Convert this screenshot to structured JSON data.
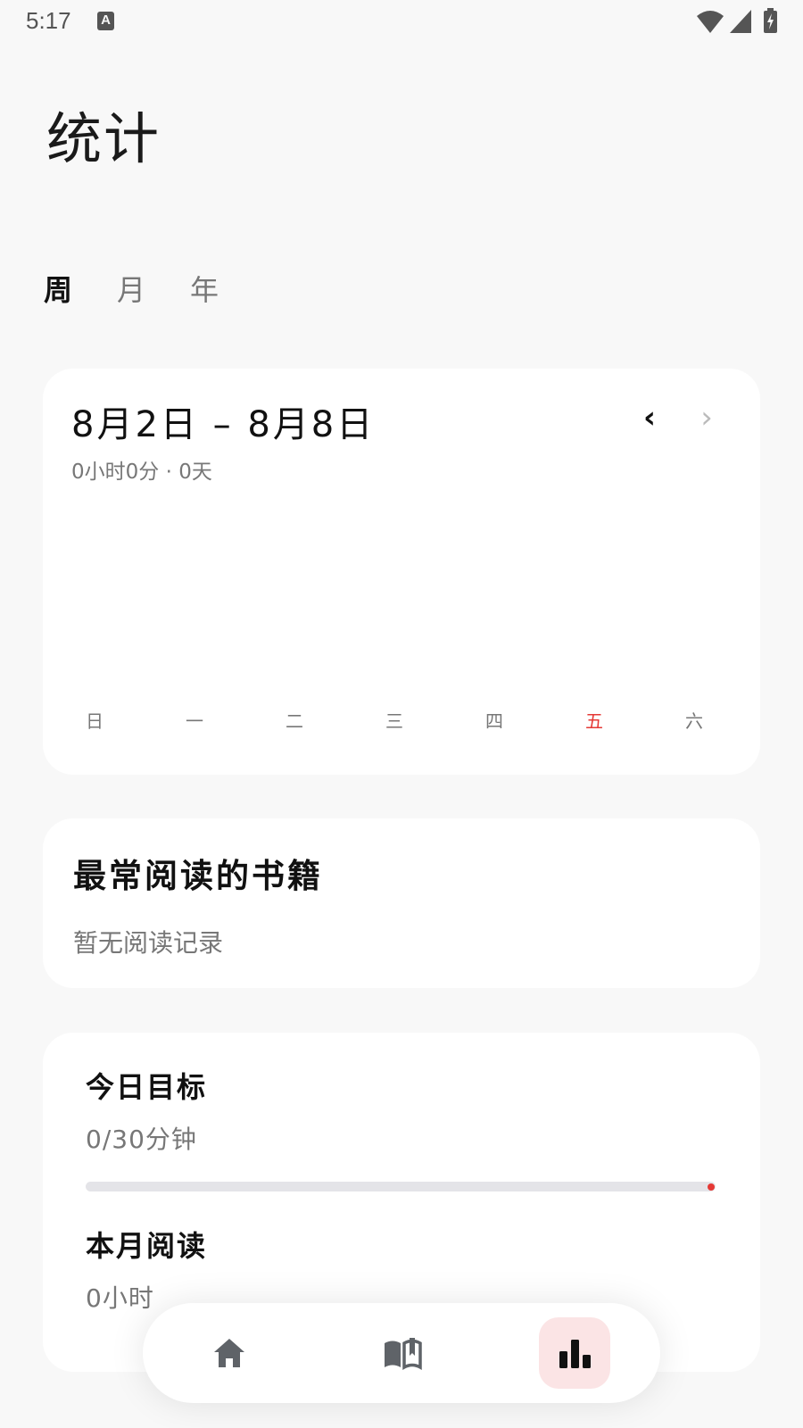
{
  "status_bar": {
    "time": "5:17",
    "notification_icon": "A"
  },
  "page": {
    "title": "统计"
  },
  "tabs": [
    {
      "label": "周",
      "active": true
    },
    {
      "label": "月",
      "active": false
    },
    {
      "label": "年",
      "active": false
    }
  ],
  "week_card": {
    "range": "8月2日 – 8月8日",
    "summary": "0小时0分 · 0天",
    "prev_icon": "‹",
    "next_icon": "›"
  },
  "chart_data": {
    "type": "bar",
    "categories": [
      "日",
      "一",
      "二",
      "三",
      "四",
      "五",
      "六"
    ],
    "values": [
      0,
      0,
      0,
      0,
      0,
      0,
      0
    ],
    "highlight_index": 5,
    "highlight_color": "#e53935",
    "label_color": "#777777"
  },
  "books_card": {
    "title": "最常阅读的书籍",
    "empty_text": "暂无阅读记录"
  },
  "goals_card": {
    "today_title": "今日目标",
    "today_value": "0/30分钟",
    "today_progress": 0,
    "month_title": "本月阅读",
    "month_value": "0小时"
  },
  "bottom_nav": {
    "items": [
      "home-icon",
      "book-icon",
      "stats-icon"
    ],
    "active": "stats-icon"
  },
  "colors": {
    "accent": "#e53935",
    "active_nav_bg": "#fbe4e5",
    "background": "#f8f8f8"
  }
}
